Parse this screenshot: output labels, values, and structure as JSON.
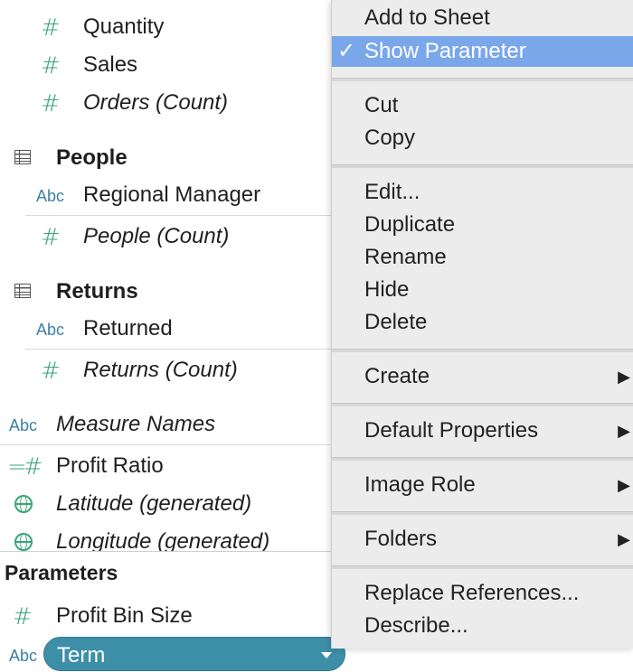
{
  "fields": {
    "quantity": "Quantity",
    "sales": "Sales",
    "orders_count": "Orders (Count)",
    "people_table": "People",
    "regional_manager": "Regional Manager",
    "people_count": "People (Count)",
    "returns_table": "Returns",
    "returned": "Returned",
    "returns_count": "Returns (Count)",
    "measure_names": "Measure Names",
    "profit_ratio": "Profit Ratio",
    "latitude": "Latitude (generated)",
    "longitude": "Longitude (generated)"
  },
  "icons": {
    "hash": "#",
    "abc": "Abc",
    "calc_hash": "=#"
  },
  "parameters": {
    "header": "Parameters",
    "profit_bin_size": "Profit Bin Size",
    "term": "Term"
  },
  "menu": {
    "check_glyph": "✓",
    "submenu_glyph": "▶",
    "items": [
      "Add to Sheet",
      "Show Parameter",
      "Cut",
      "Copy",
      "Edit...",
      "Duplicate",
      "Rename",
      "Hide",
      "Delete",
      "Create",
      "Default Properties",
      "Image Role",
      "Folders",
      "Replace References...",
      "Describe..."
    ]
  },
  "colors": {
    "measure_green": "#3aa57a",
    "dimension_blue": "#3d7fa8",
    "menu_highlight": "#7aa7ea",
    "pill": "#3d8fa8"
  }
}
